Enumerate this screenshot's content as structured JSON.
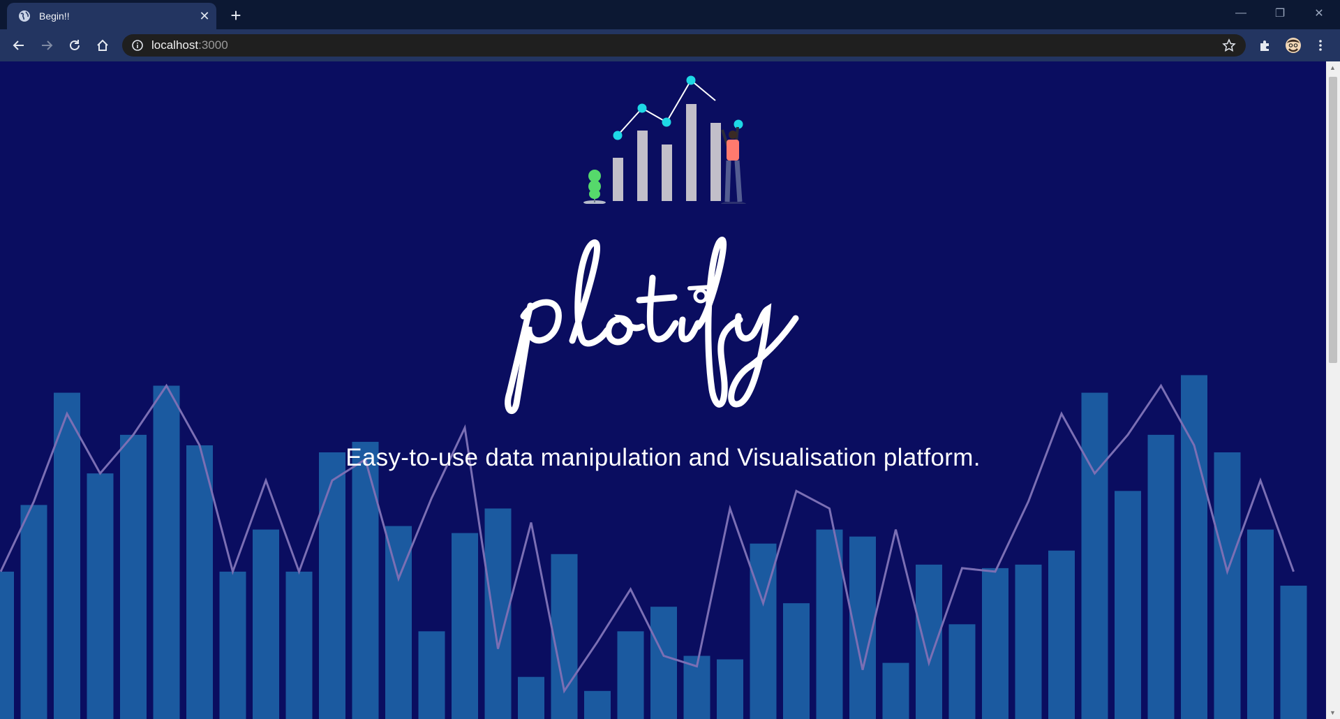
{
  "browser": {
    "tab_title": "Begin!!",
    "url_host": "localhost",
    "url_port": ":3000"
  },
  "page": {
    "brand": "plotify",
    "tagline": "Easy-to-use data manipulation and Visualisation platform."
  },
  "colors": {
    "background": "#0a0d60",
    "bar": "#1b5aa0",
    "line": "#7b6fb4",
    "accent_dot": "#1ed8e6"
  },
  "icons": [
    "globe-icon",
    "close-icon",
    "plus-icon",
    "back-icon",
    "forward-icon",
    "reload-icon",
    "home-icon",
    "info-icon",
    "star-icon",
    "extensions-icon",
    "profile-avatar",
    "menu-icon"
  ],
  "chart_data": {
    "type": "bar",
    "values": [
      22,
      41,
      73,
      50,
      61,
      75,
      58,
      22,
      34,
      22,
      56,
      59,
      35,
      5,
      33,
      40,
      -8,
      27,
      -12,
      5,
      12,
      -2,
      -3,
      30,
      13,
      34,
      32,
      -4,
      24,
      7,
      23,
      24,
      28,
      73,
      45,
      61,
      78,
      56,
      34,
      18
    ],
    "line_values": [
      22,
      42,
      67,
      50,
      61,
      75,
      58,
      22,
      48,
      22,
      48,
      54,
      20,
      43,
      63,
      0,
      36,
      -12,
      2,
      17,
      -2,
      -5,
      40,
      13,
      45,
      40,
      -6,
      34,
      -4,
      23,
      22,
      42,
      67,
      50,
      61,
      75,
      58,
      22,
      48,
      22
    ]
  }
}
